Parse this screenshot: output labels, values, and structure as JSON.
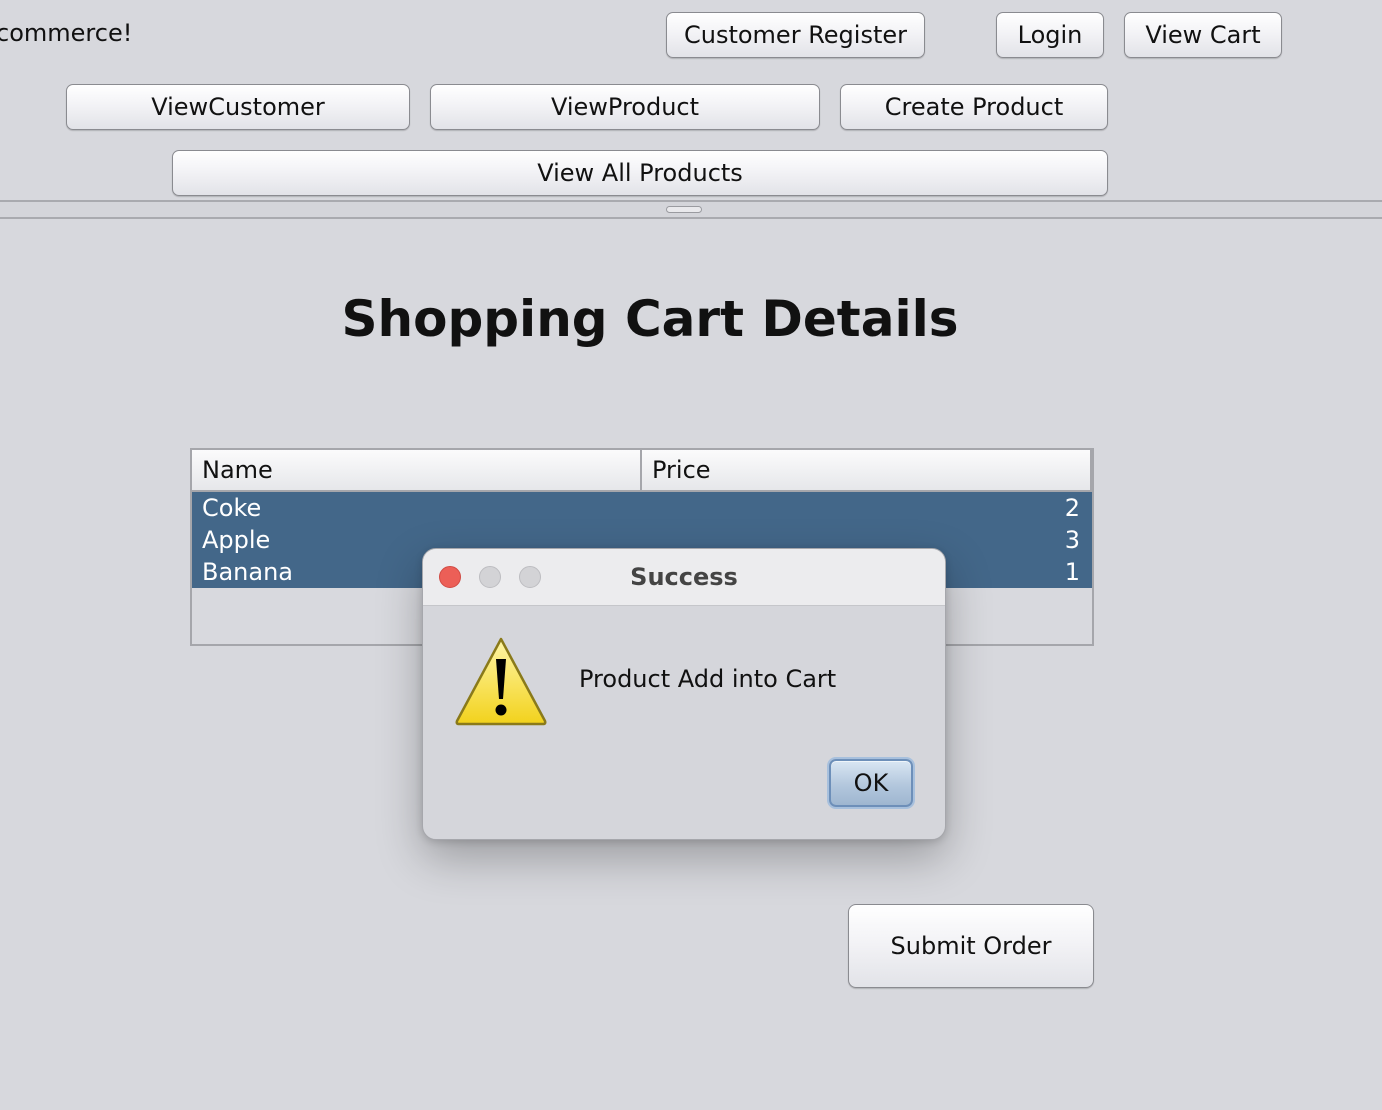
{
  "header": {
    "welcome_text": "commerce!",
    "buttons": {
      "customer_register": "Customer Register",
      "login": "Login",
      "view_cart": "View Cart",
      "view_customer": "ViewCustomer",
      "view_product": "ViewProduct",
      "create_product": "Create Product",
      "view_all_products": "View All Products"
    }
  },
  "cart": {
    "title": "Shopping Cart Details",
    "columns": [
      "Name",
      "Price"
    ],
    "rows": [
      {
        "name": "Coke",
        "price": "2"
      },
      {
        "name": "Apple",
        "price": "3"
      },
      {
        "name": "Banana",
        "price": "1"
      }
    ],
    "submit_label": "Submit Order"
  },
  "dialog": {
    "title": "Success",
    "message": "Product Add into Cart",
    "ok_label": "OK",
    "icon": "warning-icon"
  },
  "colors": {
    "background": "#d7d8dd",
    "selection": "#436789",
    "close_button": "#ec5f57"
  }
}
